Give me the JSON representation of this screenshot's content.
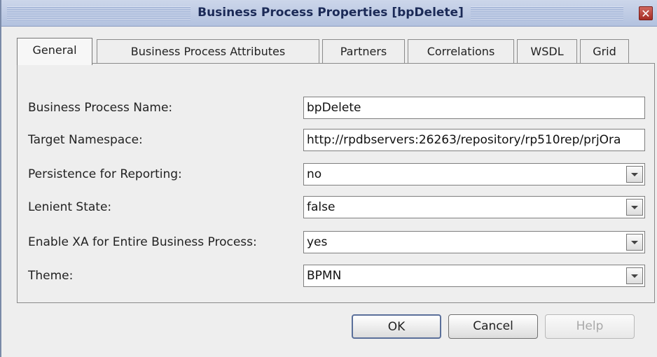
{
  "window": {
    "title": "Business Process Properties [bpDelete]",
    "close_glyph": "✕"
  },
  "tabs": [
    {
      "label": "General",
      "active": true
    },
    {
      "label": "Business Process Attributes"
    },
    {
      "label": "Partners"
    },
    {
      "label": "Correlations"
    },
    {
      "label": "WSDL"
    },
    {
      "label": "Grid"
    }
  ],
  "form": {
    "name_label": "Business Process Name:",
    "name_value": "bpDelete",
    "namespace_label": "Target Namespace:",
    "namespace_value": "http://rpdbservers:26263/repository/rp510rep/prjOra",
    "persistence_label": "Persistence for Reporting:",
    "persistence_value": "no",
    "lenient_label": "Lenient State:",
    "lenient_value": "false",
    "xa_label": "Enable XA for Entire Business Process:",
    "xa_value": "yes",
    "theme_label": "Theme:",
    "theme_value": "BPMN"
  },
  "buttons": {
    "ok": "OK",
    "cancel": "Cancel",
    "help": "Help"
  }
}
